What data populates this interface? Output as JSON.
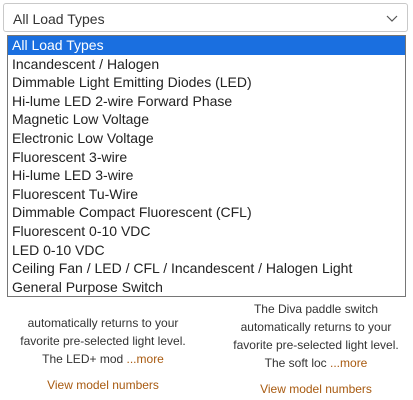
{
  "load_type_filter": {
    "selected_value": "All Load Types",
    "options": [
      "All Load Types",
      "Incandescent / Halogen",
      "Dimmable Light Emitting Diodes (LED)",
      "Hi-lume LED 2-wire Forward Phase",
      "Magnetic Low Voltage",
      "Electronic Low Voltage",
      "Fluorescent 3-wire",
      "Hi-lume LED 3-wire",
      "Fluorescent Tu-Wire",
      "Dimmable Compact Fluorescent (CFL)",
      "Fluorescent 0-10 VDC",
      "LED 0-10 VDC",
      "Ceiling Fan / LED / CFL / Incandescent / Halogen Light",
      "General Purpose Switch"
    ],
    "highlighted_index": 0,
    "highlight_color": "#1a6fe0"
  },
  "products": [
    {
      "description_lines": [
        "automatically returns to your",
        "favorite pre-selected light level.",
        "The LED+ mod"
      ],
      "more_label": "...more",
      "view_models_label": "View model numbers"
    },
    {
      "description_lines": [
        "The Diva paddle switch",
        "automatically returns to your",
        "favorite pre-selected light level.",
        "The soft loc"
      ],
      "more_label": "...more",
      "view_models_label": "View model numbers"
    }
  ],
  "link_color": "#a85a10"
}
